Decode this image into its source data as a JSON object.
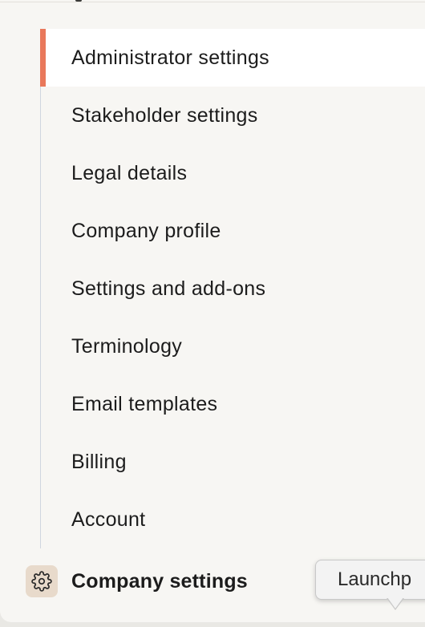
{
  "submenu": {
    "items": [
      {
        "label": "Administrator settings",
        "active": true
      },
      {
        "label": "Stakeholder settings"
      },
      {
        "label": "Legal details"
      },
      {
        "label": "Company profile"
      },
      {
        "label": "Settings and add-ons"
      },
      {
        "label": "Terminology"
      },
      {
        "label": "Email templates"
      },
      {
        "label": "Billing"
      },
      {
        "label": "Account"
      }
    ]
  },
  "nav": {
    "company_settings_label": "Company settings",
    "company_settings_icon": "gear-icon"
  },
  "tooltip": {
    "text": "Launchp"
  },
  "colors": {
    "active_accent": "#e9785b",
    "icon_background": "#e8dacb",
    "panel_background": "#f7f6f3"
  }
}
